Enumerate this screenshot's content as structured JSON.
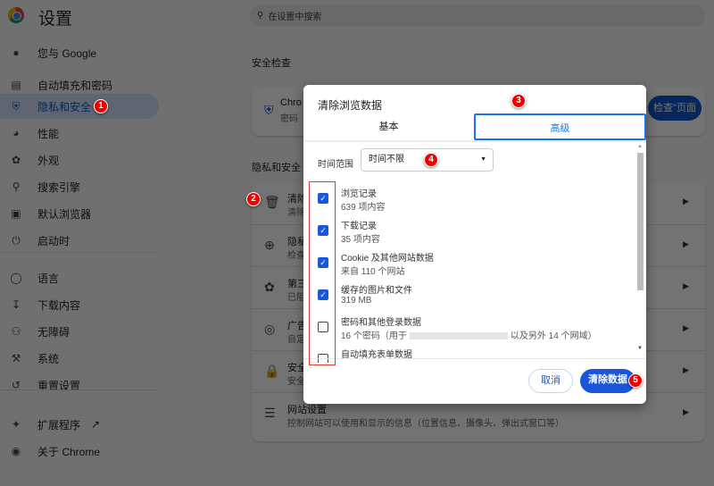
{
  "app": {
    "title": "设置",
    "search_placeholder": "在设置中搜索"
  },
  "sidebar": {
    "items": [
      {
        "label": "您与 Google",
        "icon": "person-icon"
      },
      {
        "label": "自动填充和密码",
        "icon": "clipboard-icon"
      },
      {
        "label": "隐私和安全",
        "icon": "shield-icon",
        "active": true
      },
      {
        "label": "性能",
        "icon": "speedometer-icon"
      },
      {
        "label": "外观",
        "icon": "palette-icon"
      },
      {
        "label": "搜索引擎",
        "icon": "search-icon"
      },
      {
        "label": "默认浏览器",
        "icon": "browser-icon"
      },
      {
        "label": "启动时",
        "icon": "power-icon"
      },
      {
        "label": "语言",
        "icon": "globe-icon"
      },
      {
        "label": "下载内容",
        "icon": "download-icon"
      },
      {
        "label": "无障碍",
        "icon": "accessibility-icon"
      },
      {
        "label": "系统",
        "icon": "wrench-icon"
      },
      {
        "label": "重置设置",
        "icon": "history-icon"
      },
      {
        "label": "扩展程序",
        "icon": "puzzle-icon"
      },
      {
        "label": "关于 Chrome",
        "icon": "chrome-icon"
      }
    ]
  },
  "main": {
    "safety_heading": "安全检查",
    "safety_card": {
      "line1": "Chro",
      "line2": "密码",
      "button": "检查\"页面"
    },
    "privacy_heading": "隐私和安全",
    "rows": [
      {
        "t1": "清除",
        "t2": "清除"
      },
      {
        "t1": "隐私",
        "t2": "检查"
      },
      {
        "t1": "第三",
        "t2": "已阻"
      },
      {
        "t1": "广告",
        "t2": "自定"
      },
      {
        "t1": "安全",
        "t2": "安全"
      },
      {
        "t1": "网站设置",
        "t2": "控制网站可以使用和显示的信息（位置信息、摄像头、弹出式窗口等）"
      }
    ]
  },
  "dialog": {
    "title": "清除浏览数据",
    "tabs": [
      {
        "label": "基本"
      },
      {
        "label": "高级",
        "selected": true
      }
    ],
    "time_range_label": "时间范围",
    "time_range_value": "时间不限",
    "items": [
      {
        "title": "浏览记录",
        "sub": "639 项内容",
        "checked": true
      },
      {
        "title": "下载记录",
        "sub": "35 项内容",
        "checked": true
      },
      {
        "title": "Cookie 及其他网站数据",
        "sub": "来自 110 个网站",
        "checked": true
      },
      {
        "title": "缓存的图片和文件",
        "sub": "319 MB",
        "checked": true
      },
      {
        "title": "密码和其他登录数据",
        "sub_prefix": "16 个密码（用于",
        "sub_suffix": "以及另外 14 个网域）",
        "checked": false
      },
      {
        "title": "自动填充表单数据",
        "checked": false
      }
    ],
    "cancel": "取消",
    "clear": "清除数据"
  },
  "annotations": [
    "1",
    "2",
    "3",
    "4",
    "5"
  ],
  "colors": {
    "accent": "#1a56db",
    "annotation": "#e00000"
  }
}
